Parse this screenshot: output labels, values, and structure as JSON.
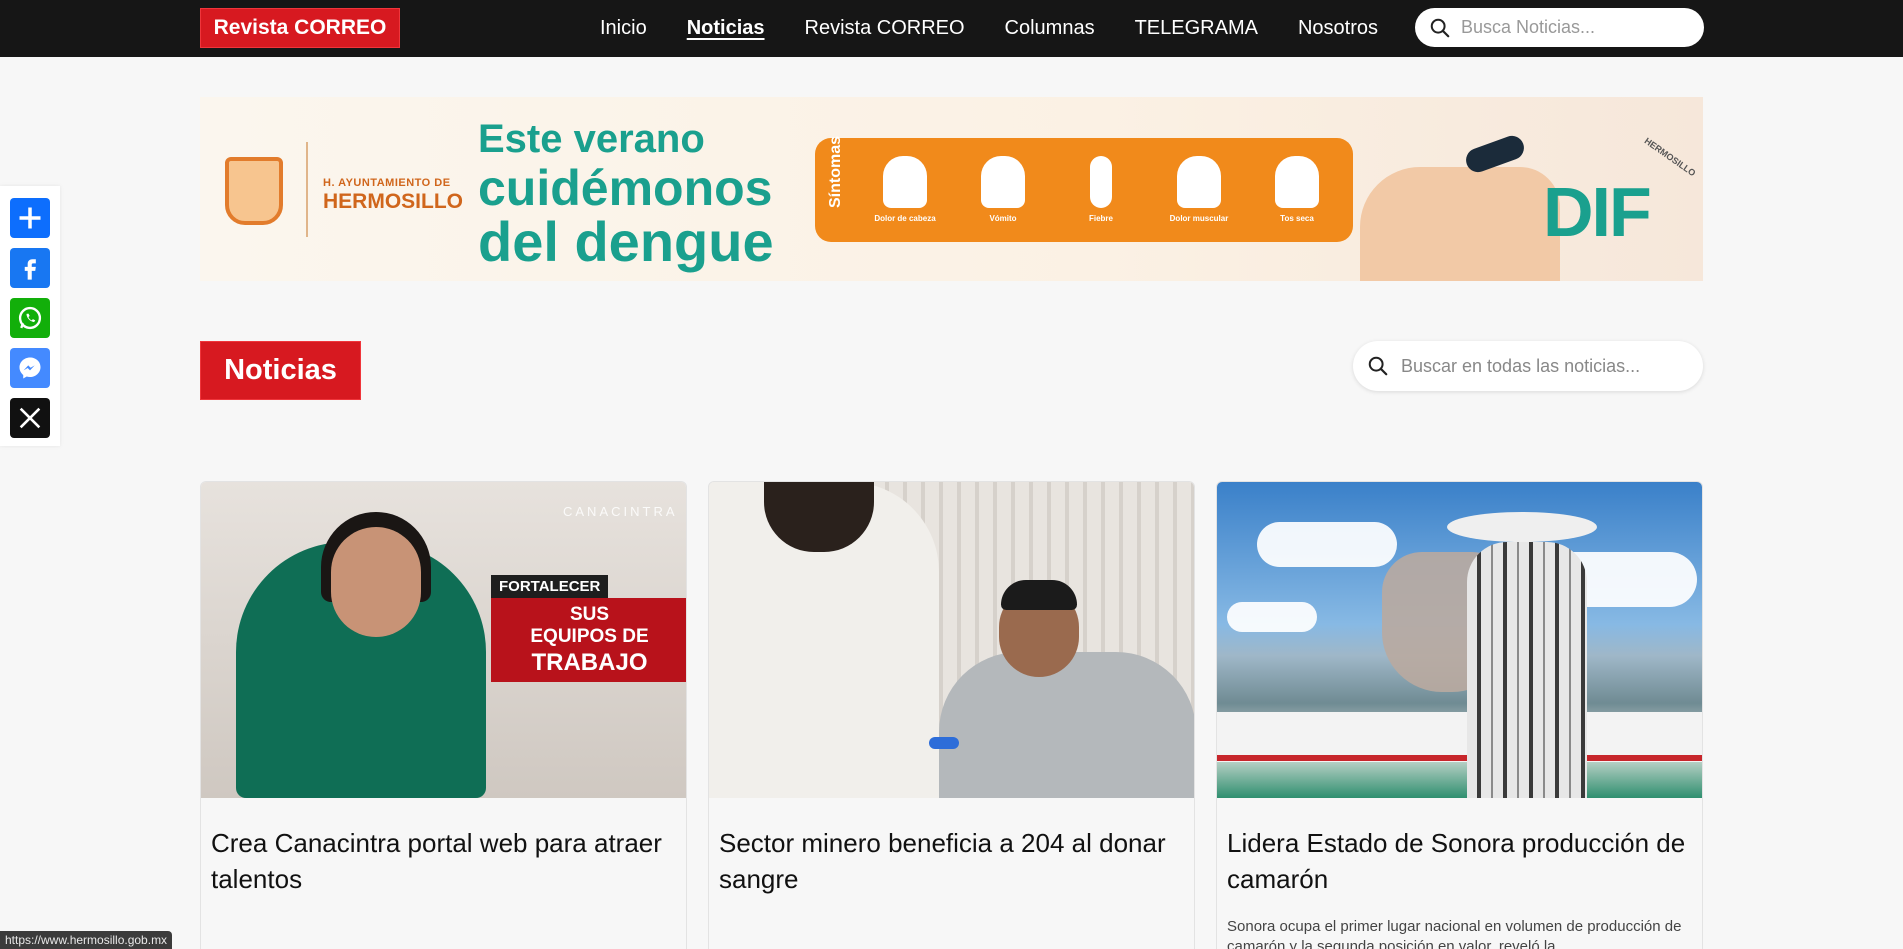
{
  "header": {
    "brand": "Revista CORREO",
    "nav": [
      "Inicio",
      "Noticias",
      "Revista CORREO",
      "Columnas",
      "TELEGRAMA",
      "Nosotros"
    ],
    "active_nav": "Noticias",
    "search_placeholder": "Busca Noticias..."
  },
  "share": {
    "buttons": [
      "share-plus-icon",
      "facebook-icon",
      "whatsapp-icon",
      "messenger-icon",
      "x-icon"
    ]
  },
  "banner": {
    "ayuntamiento_line1": "H. AYUNTAMIENTO DE",
    "ayuntamiento_line2": "HERMOSILLO",
    "headline_1": "Este verano",
    "headline_2": "cuidémonos",
    "headline_3": "del dengue",
    "symptoms_title": "Síntomas",
    "symptoms": [
      "Dolor de cabeza",
      "Vómito",
      "Fiebre",
      "Dolor muscular",
      "Tos seca"
    ],
    "dif": "DIF",
    "dif_city": "HERMOSILLO"
  },
  "section": {
    "title": "Noticias",
    "search_placeholder": "Buscar en todas las noticias..."
  },
  "cards": [
    {
      "title": "Crea Canacintra portal web para atraer talentos",
      "excerpt": "",
      "image_tag": "FORTALECER",
      "image_line1": "SUS",
      "image_line2": "EQUIPOS DE",
      "image_line3": "TRABAJO",
      "image_watermark": "CANACINTRA"
    },
    {
      "title": "Sector minero beneficia a 204 al donar sangre",
      "excerpt": ""
    },
    {
      "title": "Lidera Estado de Sonora producción de camarón",
      "excerpt": "Sonora ocupa el primer lugar  nacional en volumen de producción  de camarón y la segunda posición en valor, reveló la"
    }
  ],
  "status_url": "https://www.hermosillo.gob.mx",
  "colors": {
    "brand_red": "#d71920",
    "topbar": "#161616",
    "background": "#f7f7f7"
  }
}
